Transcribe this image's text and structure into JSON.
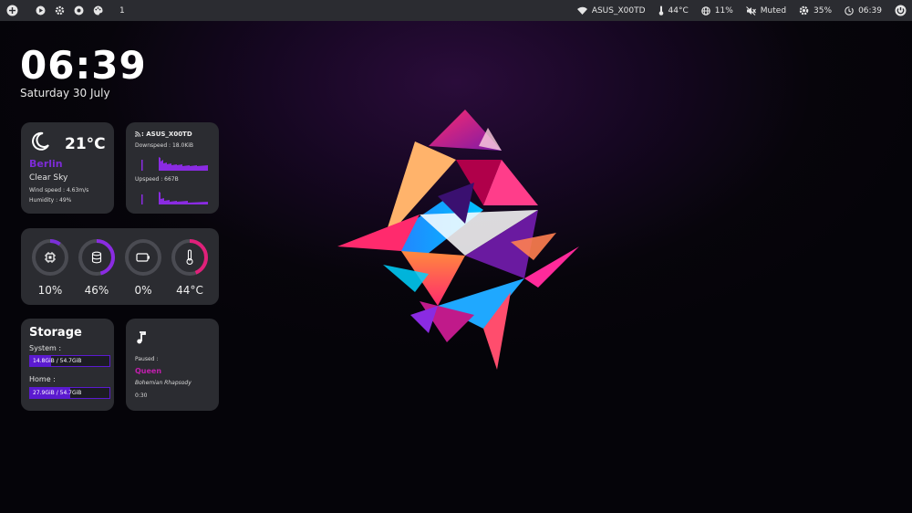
{
  "topbar": {
    "workspace": "1",
    "wifi_name": "ASUS_X00TD",
    "temperature": "44°C",
    "cpu": "11%",
    "volume": "Muted",
    "brightness": "35%",
    "time": "06:39"
  },
  "clock": {
    "time": "06:39",
    "date": "Saturday 30 July"
  },
  "weather": {
    "temp": "21°C",
    "city": "Berlin",
    "condition": "Clear Sky",
    "wind": "Wind speed : 4.63m/s",
    "humidity": "Humidity : 49%"
  },
  "network": {
    "title": ": ASUS_X00TD",
    "downspeed": "Downspeed : 18.0KiB",
    "upspeed": "Upspeed : 667B"
  },
  "stats": [
    {
      "name": "cpu",
      "value": "10%",
      "fraction": 0.1,
      "color": "#7a2fd8"
    },
    {
      "name": "ram",
      "value": "46%",
      "fraction": 0.46,
      "color": "#8a2be2"
    },
    {
      "name": "battery",
      "value": "0%",
      "fraction": 0.0,
      "color": "#8a2be2"
    },
    {
      "name": "temperature",
      "value": "44°C",
      "fraction": 0.44,
      "color": "#e0207a"
    }
  ],
  "storage": {
    "title": "Storage",
    "system_label": "System :",
    "system_value": "14.8GiB / 54.7GiB",
    "system_fraction": 0.27,
    "home_label": "Home :",
    "home_value": "27.9GiB / 54.7GiB",
    "home_fraction": 0.51
  },
  "music": {
    "status": "Paused :",
    "artist": "Queen",
    "title": "Bohemian Rhapsody",
    "time": "0:30"
  },
  "colors": {
    "accent": "#7c2bd6",
    "pink": "#e0207a",
    "card": "#2b2c31"
  }
}
